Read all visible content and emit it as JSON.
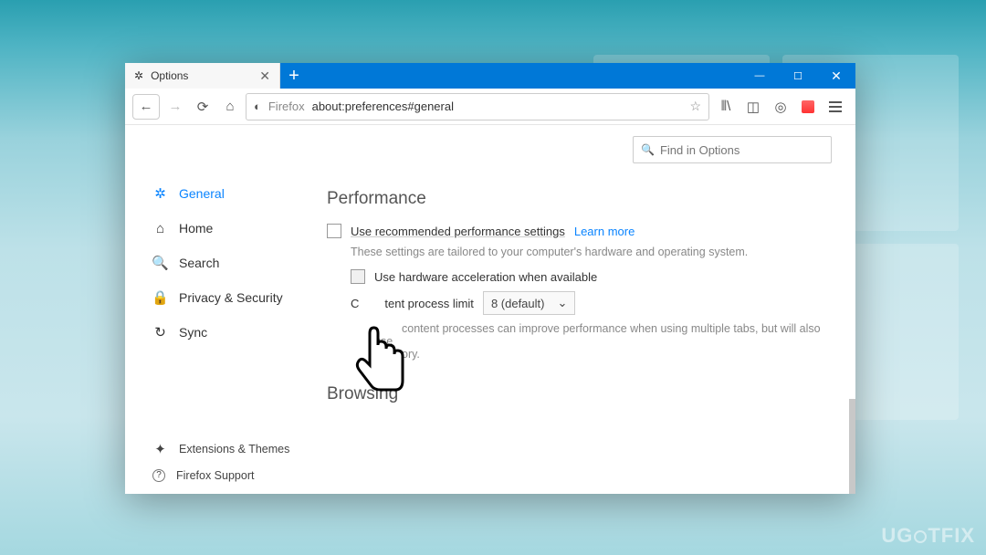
{
  "window": {
    "tab_title": "Options",
    "new_tab_plus": "+",
    "win_min": "—",
    "win_max": "☐",
    "win_close": "✕"
  },
  "urlbar": {
    "back": "←",
    "forward": "→",
    "reload": "⟳",
    "home": "⌂",
    "firefox_label": "Firefox",
    "address": "about:preferences#general",
    "star": "☆",
    "library": "⫴\\",
    "sidebar": "◫",
    "account": "◎",
    "pocket_fallback": ""
  },
  "sidebar": {
    "items": [
      {
        "icon": "✲",
        "label": "General",
        "active": true
      },
      {
        "icon": "⌂",
        "label": "Home",
        "active": false
      },
      {
        "icon": "🔍",
        "label": "Search",
        "active": false
      },
      {
        "icon": "🔒",
        "label": "Privacy & Security",
        "active": false
      },
      {
        "icon": "↻",
        "label": "Sync",
        "active": false
      }
    ],
    "ext_icon": "✦",
    "ext_label": "Extensions & Themes",
    "support_icon": "?",
    "support_label": "Firefox Support"
  },
  "search": {
    "icon": "🔍",
    "placeholder": "Find in Options"
  },
  "perf": {
    "title": "Performance",
    "use_recommended": "Use recommended performance settings",
    "learn_more": "Learn more",
    "hint": "These settings are tailored to your computer's hardware and operating system.",
    "hw_accel": "Use hardware acceleration when available",
    "content_limit_label_left": "C",
    "content_limit_label_right": "tent process limit",
    "select_value": "8 (default)",
    "select_arrow": "⌄",
    "note_left": "",
    "note_right": "content processes can improve performance when using multiple tabs, but will also use",
    "note_tail": "ory."
  },
  "browsing": {
    "title": "Browsing"
  },
  "watermark": "UG   TFIX"
}
